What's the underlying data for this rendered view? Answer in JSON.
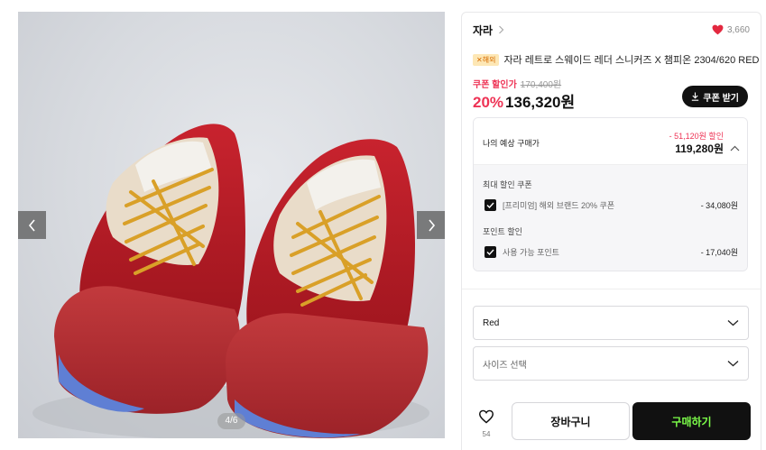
{
  "gallery": {
    "counter": "4/6",
    "prev_icon": "chevron-left-icon",
    "next_icon": "chevron-right-icon"
  },
  "product": {
    "brand": "자라",
    "likes": "3,660",
    "badge": "✕해외",
    "title": "자라 레트로 스웨이드 레더 스니커즈 X 챔피온 2304/620 RED",
    "coupon_label": "쿠폰 할인가",
    "original_price": "170,400원",
    "discount_pct": "20%",
    "price": "136,320원",
    "coupon_button": "쿠폰 받기"
  },
  "estimate": {
    "label": "나의 예상 구매가",
    "discount": "- 51,120원 할인",
    "price": "119,280원",
    "coupon_section": "최대 할인 쿠폰",
    "coupon_item": "[프리미엄] 해외 브랜드 20% 쿠폰",
    "coupon_amount": "- 34,080원",
    "point_section": "포인트 할인",
    "point_item": "사용 가능 포인트",
    "point_amount": "- 17,040원"
  },
  "options": {
    "color_value": "Red",
    "size_placeholder": "사이즈 선택"
  },
  "actions": {
    "wish_count": "54",
    "cart_label": "장바구니",
    "buy_label": "구매하기"
  },
  "colors": {
    "accent_red": "#ee3355",
    "buy_text": "#7dff4a",
    "dark": "#111111"
  }
}
